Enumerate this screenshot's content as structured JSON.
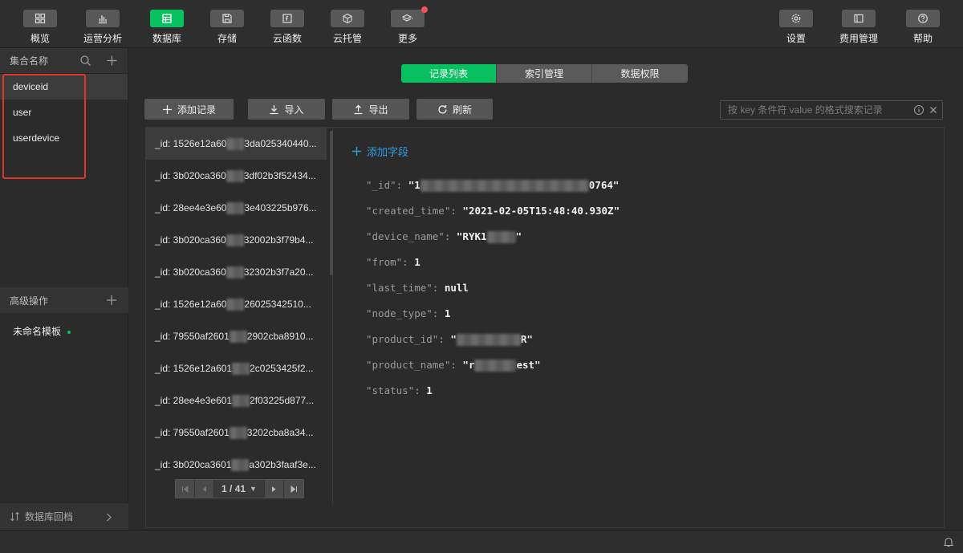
{
  "toolbar": {
    "left": [
      {
        "label": "概览",
        "icon": "grid-icon"
      },
      {
        "label": "运营分析",
        "icon": "bar-chart-icon"
      },
      {
        "label": "数据库",
        "icon": "database-icon",
        "active": true
      },
      {
        "label": "存储",
        "icon": "save-icon"
      },
      {
        "label": "云函数",
        "icon": "function-icon"
      },
      {
        "label": "云托管",
        "icon": "box-icon"
      },
      {
        "label": "更多",
        "icon": "layers-icon",
        "badge": true
      }
    ],
    "right": [
      {
        "label": "设置",
        "icon": "gear-icon"
      },
      {
        "label": "费用管理",
        "icon": "billing-icon"
      },
      {
        "label": "帮助",
        "icon": "help-icon"
      }
    ]
  },
  "sidebar": {
    "collections_header": "集合名称",
    "collections": [
      "deviceid",
      "user",
      "userdevice"
    ],
    "advanced_header": "高级操作",
    "template_item": "未命名模板",
    "footer": "数据库回档"
  },
  "tabs": [
    "记录列表",
    "索引管理",
    "数据权限"
  ],
  "actions": {
    "add": "添加记录",
    "import": "导入",
    "export": "导出",
    "refresh": "刷新"
  },
  "search": {
    "placeholder": "按 key 条件符 value 的格式搜索记录"
  },
  "records": [
    {
      "prefix": "_id: 1526e12a60",
      "suffix": "3da025340440..."
    },
    {
      "prefix": "_id: 3b020ca360",
      "suffix": "3df02b3f52434..."
    },
    {
      "prefix": "_id: 28ee4e3e60",
      "suffix": "3e403225b976..."
    },
    {
      "prefix": "_id: 3b020ca360",
      "suffix": "32002b3f79b4..."
    },
    {
      "prefix": "_id: 3b020ca360",
      "suffix": "32302b3f7a20..."
    },
    {
      "prefix": "_id: 1526e12a60",
      "suffix": "26025342510..."
    },
    {
      "prefix": "_id: 79550af2601",
      "suffix": "2902cba8910..."
    },
    {
      "prefix": "_id: 1526e12a601",
      "suffix": "2c0253425f2..."
    },
    {
      "prefix": "_id: 28ee4e3e601",
      "suffix": "2f03225d877..."
    },
    {
      "prefix": "_id: 79550af2601",
      "suffix": "3202cba8a34..."
    },
    {
      "prefix": "_id: 3b020ca3601",
      "suffix": "a302b3faaf3e..."
    }
  ],
  "pagination": {
    "text": "1 / 41"
  },
  "detail": {
    "add_field": "添加字段",
    "fields": [
      {
        "key": "\"_id\"",
        "pre": "\"1",
        "post": "0764\""
      },
      {
        "key": "\"created_time\"",
        "pre": "\"2021-02-05T15:48:40.930Z\"",
        "post": ""
      },
      {
        "key": "\"device_name\"",
        "pre": "\"RYK1",
        "post": "\""
      },
      {
        "key": "\"from\"",
        "pre": "1",
        "post": ""
      },
      {
        "key": "\"last_time\"",
        "pre": "null",
        "post": ""
      },
      {
        "key": "\"node_type\"",
        "pre": "1",
        "post": ""
      },
      {
        "key": "\"product_id\"",
        "pre": "\"",
        "post": "R\""
      },
      {
        "key": "\"product_name\"",
        "pre": "\"r",
        "post": "est\""
      },
      {
        "key": "\"status\"",
        "pre": "1",
        "post": ""
      }
    ]
  }
}
